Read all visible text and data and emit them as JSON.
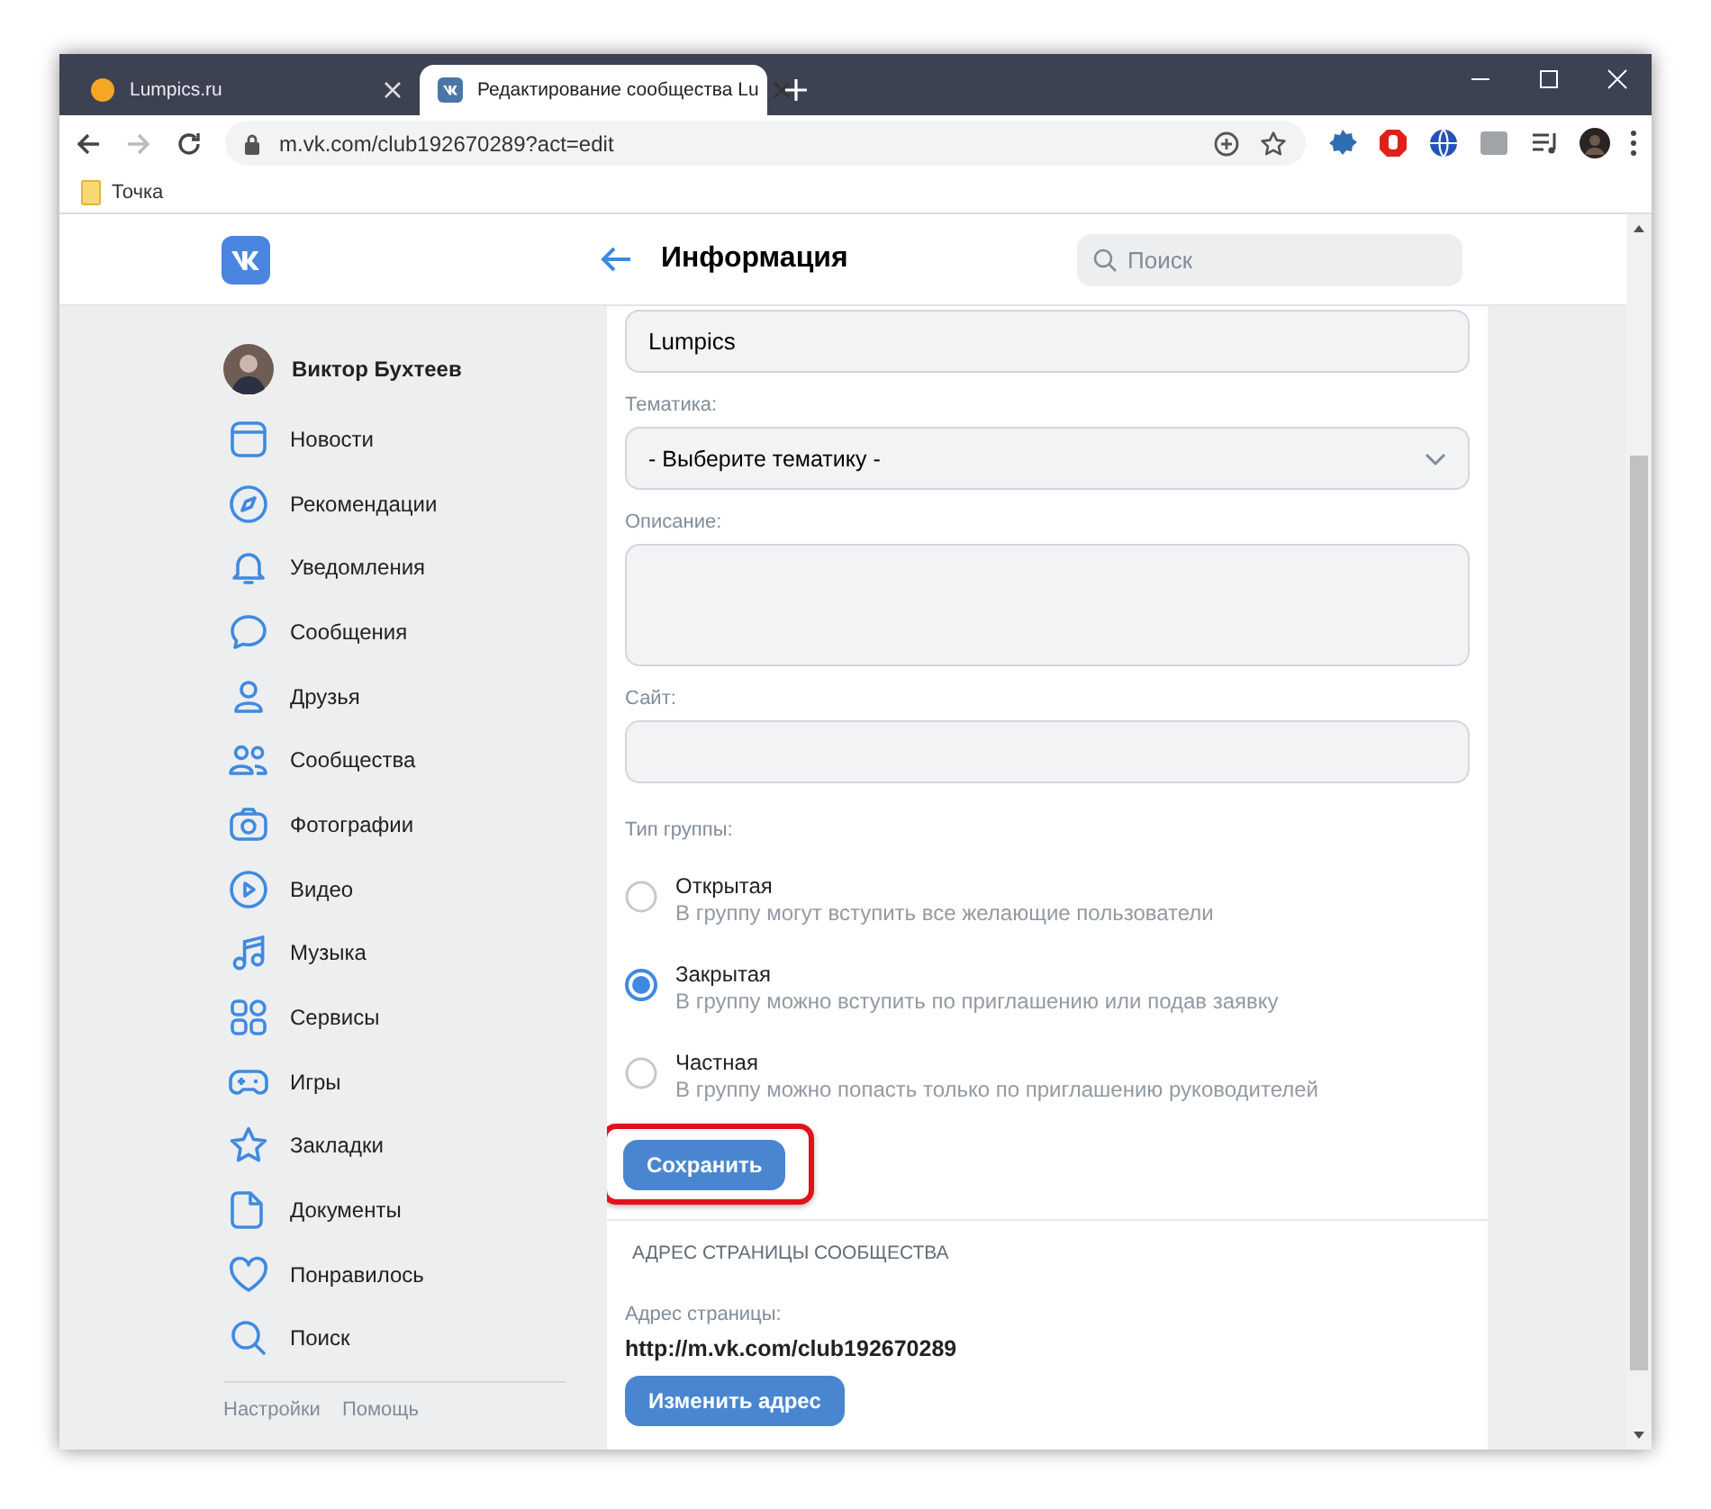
{
  "browser": {
    "tabs": [
      {
        "title": "Lumpics.ru",
        "selected": false
      },
      {
        "title": "Редактирование сообщества Lu",
        "selected": true
      }
    ],
    "address": "m.vk.com/club192670289?act=edit",
    "bookmarks": [
      "Точка"
    ]
  },
  "header": {
    "title": "Информация",
    "search": {
      "placeholder": "Поиск"
    }
  },
  "sidebar": {
    "profile": "Виктор Бухтеев",
    "items": [
      "Новости",
      "Рекомендации",
      "Уведомления",
      "Сообщения",
      "Друзья",
      "Сообщества",
      "Фотографии",
      "Видео",
      "Музыка",
      "Сервисы",
      "Игры",
      "Закладки",
      "Документы",
      "Понравилось",
      "Поиск"
    ],
    "footer": [
      "Настройки",
      "Помощь"
    ]
  },
  "form": {
    "name_field": {
      "value": "Lumpics"
    },
    "fields": [
      {
        "label": "Тематика:",
        "kind": "select",
        "value": "- Выберите тематику -"
      },
      {
        "label": "Описание:",
        "kind": "textarea"
      },
      {
        "label": "Сайт:",
        "kind": "text"
      }
    ],
    "group_type": {
      "label": "Тип группы:",
      "options": [
        {
          "title": "Открытая",
          "description": "В группу могут вступить все желающие пользователи",
          "selected": false
        },
        {
          "title": "Закрытая",
          "description": "В группу можно вступить по приглашению или подав заявку",
          "selected": true
        },
        {
          "title": "Частная",
          "description": "В группу можно попасть только по приглашению руководителей",
          "selected": false
        }
      ]
    },
    "save_button": {
      "label": "Сохранить",
      "highlighted": true
    },
    "address_section": {
      "heading": "АДРЕС СТРАНИЦЫ СООБЩЕСТВА",
      "label": "Адрес страницы:",
      "url": "http://m.vk.com/club192670289",
      "button": "Изменить адрес"
    }
  }
}
